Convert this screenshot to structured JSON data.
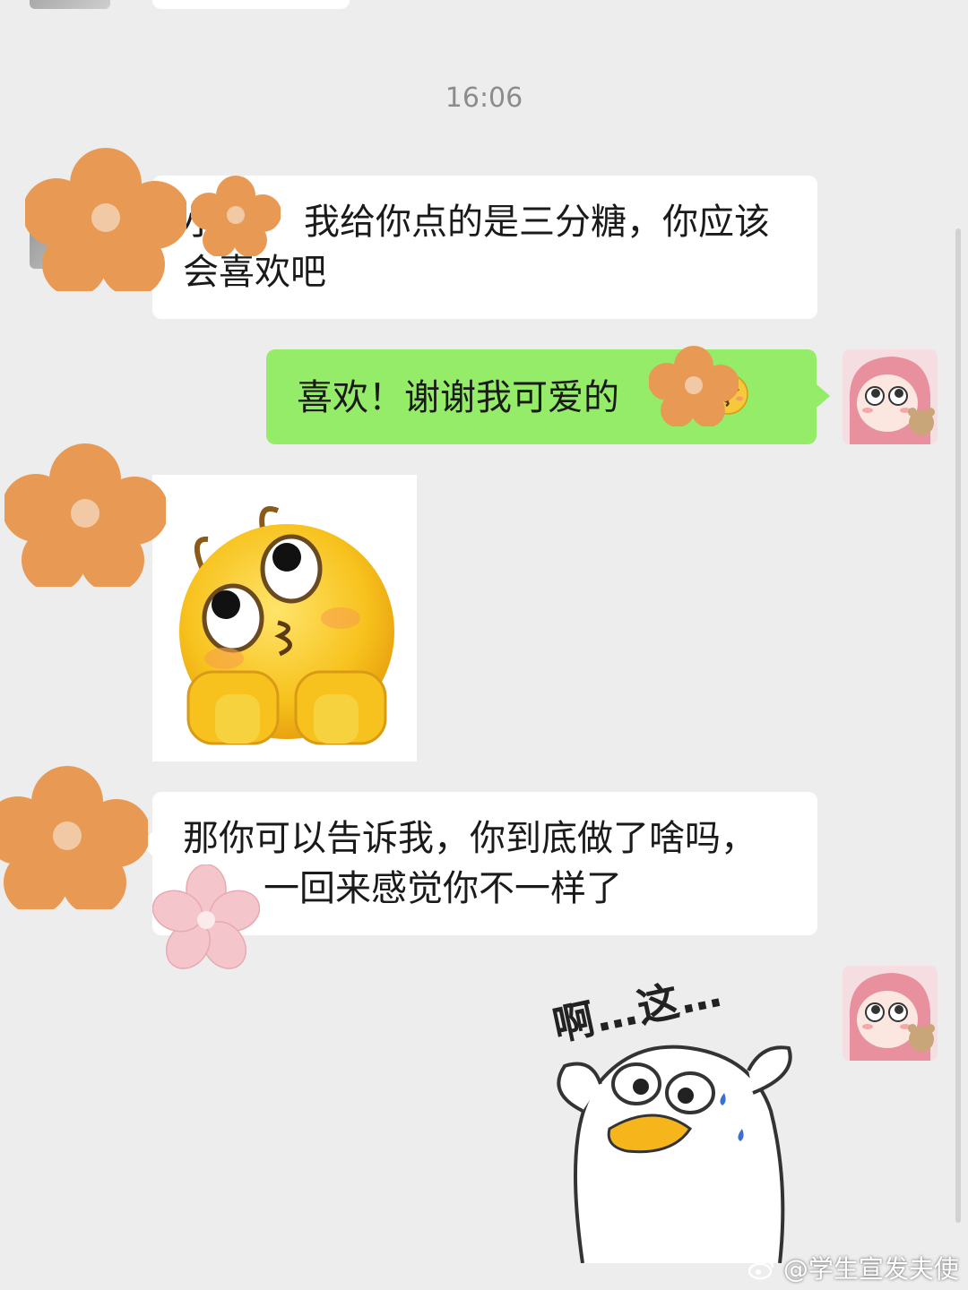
{
  "chat": {
    "timestamp": "16:06",
    "messages": [
      {
        "sender": "contact",
        "type": "text",
        "text_before": "小",
        "text_after": "我给你点的是三分糖，你应该会喜欢吧"
      },
      {
        "sender": "me",
        "type": "text",
        "text": "喜欢！谢谢我可爱的",
        "emoji": "kissing-smiling-eyes"
      },
      {
        "sender": "contact",
        "type": "sticker",
        "sticker": "yellow-face-kiss-sticker"
      },
      {
        "sender": "contact",
        "type": "text",
        "text_before": "那你可以告诉我，你到底做了啥吗，",
        "text_after": "一回来感觉你不一样了"
      },
      {
        "sender": "me",
        "type": "sticker",
        "sticker": "duck-sticker",
        "caption": "啊…这…"
      }
    ]
  },
  "watermark": {
    "text": "@学生宣发夫使"
  },
  "colors": {
    "background": "#ededed",
    "incoming_bubble": "#ffffff",
    "outgoing_bubble": "#95ec69",
    "flower_sticker": "#e89a55",
    "pink_flower": "#f4c6cc"
  }
}
